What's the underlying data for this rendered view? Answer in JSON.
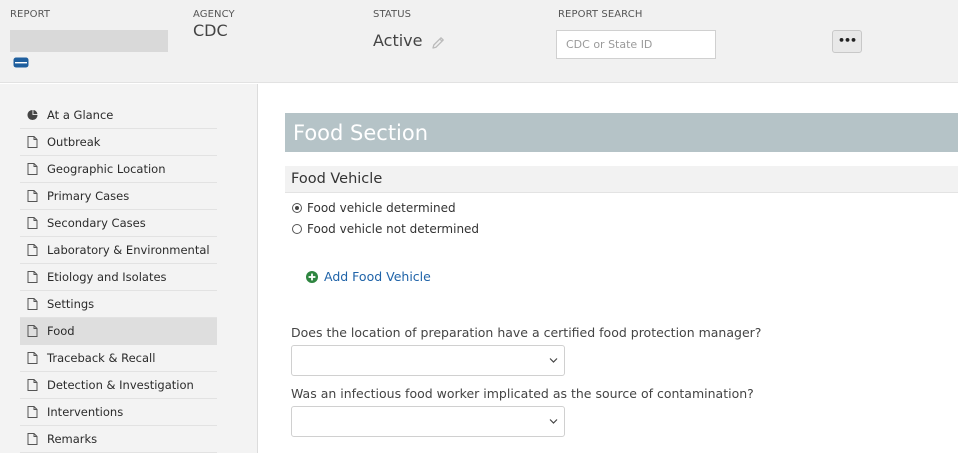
{
  "header": {
    "report_label": "REPORT",
    "agency_label": "AGENCY",
    "agency_value": "CDC",
    "status_label": "STATUS",
    "status_value": "Active",
    "report_search_label": "REPORT SEARCH",
    "report_search_placeholder": "CDC or State ID",
    "more_button_label": "•••"
  },
  "sidebar": {
    "items": [
      {
        "label": "At a Glance",
        "icon": "pie-chart-icon"
      },
      {
        "label": "Outbreak",
        "icon": "document-icon"
      },
      {
        "label": "Geographic Location",
        "icon": "document-icon"
      },
      {
        "label": "Primary Cases",
        "icon": "document-icon"
      },
      {
        "label": "Secondary Cases",
        "icon": "document-icon"
      },
      {
        "label": "Laboratory & Environmental",
        "icon": "document-icon"
      },
      {
        "label": "Etiology and Isolates",
        "icon": "document-icon"
      },
      {
        "label": "Settings",
        "icon": "document-icon"
      },
      {
        "label": "Food",
        "icon": "document-icon",
        "active": true
      },
      {
        "label": "Traceback & Recall",
        "icon": "document-icon"
      },
      {
        "label": "Detection & Investigation",
        "icon": "document-icon"
      },
      {
        "label": "Interventions",
        "icon": "document-icon"
      },
      {
        "label": "Remarks",
        "icon": "document-icon"
      }
    ]
  },
  "main": {
    "section_title": "Food Section",
    "subsection_title": "Food Vehicle",
    "radio_options": [
      {
        "label": "Food vehicle determined",
        "checked": true
      },
      {
        "label": "Food vehicle not determined",
        "checked": false
      }
    ],
    "add_link_label": "Add Food Vehicle",
    "questions": [
      {
        "label": "Does the location of preparation have a certified food protection manager?",
        "value": ""
      },
      {
        "label": "Was an infectious food worker implicated as the source of contamination?",
        "value": ""
      }
    ]
  },
  "colors": {
    "section_banner": "#b5c3c7",
    "link": "#1f63a8",
    "add_icon": "#2e8540",
    "db_icon": "#1f5f9e"
  }
}
